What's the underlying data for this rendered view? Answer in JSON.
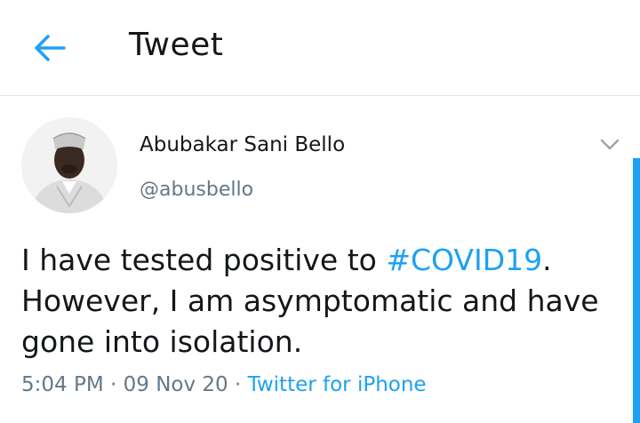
{
  "header": {
    "title": "Tweet",
    "back_icon": "arrow-left-icon"
  },
  "author": {
    "name": "Abubakar Sani Bello",
    "handle": "@abusbello"
  },
  "tweet": {
    "text_before": "I have tested positive to ",
    "hashtag": "#COVID19",
    "text_after": ". However, I am asymptomatic and have gone into isolation."
  },
  "meta": {
    "time": "5:04 PM",
    "sep1": " · ",
    "date": "09 Nov 20",
    "sep2": " · ",
    "source": "Twitter for iPhone"
  },
  "colors": {
    "accent": "#1da1f2",
    "secondary_text": "#657786",
    "divider": "#e1e4e8"
  }
}
